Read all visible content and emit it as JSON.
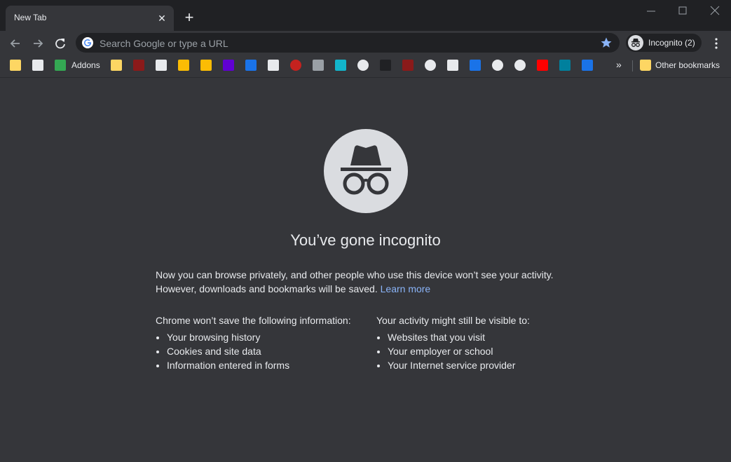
{
  "window": {
    "tab_title": "New Tab"
  },
  "toolbar": {
    "omnibox_placeholder": "Search Google or type a URL",
    "profile_label": "Incognito (2)"
  },
  "bookmarks": {
    "items": [
      {
        "icon": "folder-icon",
        "color": "#fdd663"
      },
      {
        "icon": "image-icon",
        "color": "#e8eaed"
      },
      {
        "icon": "puzzle-icon",
        "color": "#34a853",
        "label": "Addons"
      },
      {
        "icon": "folder-icon",
        "color": "#fdd663"
      },
      {
        "icon": "h-red-icon",
        "color": "#8b1a1a"
      },
      {
        "icon": "image-icon",
        "color": "#e8eaed"
      },
      {
        "icon": "h-yellow-icon",
        "color": "#fbbc04"
      },
      {
        "icon": "h-yellow-icon",
        "color": "#fbbc04"
      },
      {
        "icon": "yahoo-icon",
        "color": "#6001d2"
      },
      {
        "icon": "bw-icon",
        "color": "#1a73e8"
      },
      {
        "icon": "image-icon",
        "color": "#e8eaed"
      },
      {
        "icon": "power-icon",
        "color": "#c5221f"
      },
      {
        "icon": "hand-icon",
        "color": "#9aa0a6"
      },
      {
        "icon": "y-teal-icon",
        "color": "#12b5cb"
      },
      {
        "icon": "globe-icon",
        "color": "#e8eaed"
      },
      {
        "icon": "htg-icon",
        "color": "#202124"
      },
      {
        "icon": "h-red-icon",
        "color": "#8b1a1a"
      },
      {
        "icon": "globe-icon",
        "color": "#e8eaed"
      },
      {
        "icon": "image-icon",
        "color": "#e8eaed"
      },
      {
        "icon": "hn-icon",
        "color": "#1a73e8"
      },
      {
        "icon": "globe-icon",
        "color": "#e8eaed"
      },
      {
        "icon": "globe-icon",
        "color": "#e8eaed"
      },
      {
        "icon": "youtube-icon",
        "color": "#ff0000"
      },
      {
        "icon": "bing-icon",
        "color": "#00809d"
      },
      {
        "icon": "wp-icon",
        "color": "#1a73e8"
      }
    ],
    "other_label": "Other bookmarks"
  },
  "content": {
    "heading": "You’ve gone incognito",
    "intro_line1": "Now you can browse privately, and other people who use this device won’t see your activity.",
    "intro_line2": "However, downloads and bookmarks will be saved.",
    "learn_more": "Learn more",
    "left_title_pre": "Chrome ",
    "left_title_bold": "won’t save",
    "left_title_post": " the following information:",
    "left_items": [
      "Your browsing history",
      "Cookies and site data",
      "Information entered in forms"
    ],
    "right_title_pre": "Your activity ",
    "right_title_bold": "might still be visible",
    "right_title_post": " to:",
    "right_items": [
      "Websites that you visit",
      "Your employer or school",
      "Your Internet service provider"
    ]
  }
}
